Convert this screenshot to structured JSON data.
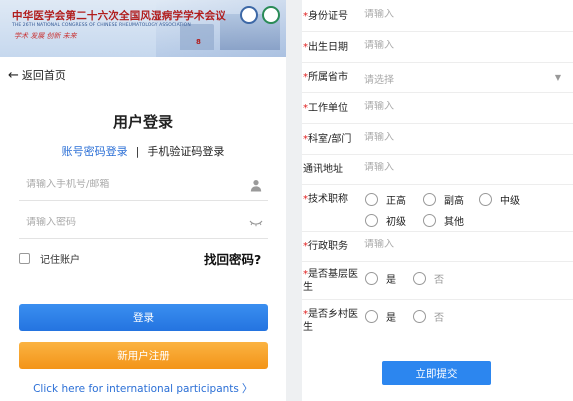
{
  "banner": {
    "title": "中华医学会第二十六次全国风湿病学学术会议",
    "subtitle": "THE 26TH NATIONAL CONGRESS OF CHINESE RHEUMATOLOGY ASSOCIATION",
    "slogan": "学术 发展 创新 未来",
    "year_mark": "8"
  },
  "nav": {
    "back_label": "返回首页"
  },
  "login": {
    "title": "用户登录",
    "tab_password": "账号密码登录",
    "tab_separator": "|",
    "tab_sms": "手机验证码登录",
    "username_placeholder": "请输入手机号/邮箱",
    "password_placeholder": "请输入密码",
    "remember_label": "记住账户",
    "forgot_label": "找回密码?",
    "login_button": "登录",
    "register_button": "新用户注册",
    "intl_link": "Click here for international participants",
    "intl_chevron": "〉"
  },
  "form": {
    "id_card": {
      "label": "身份证号",
      "placeholder": "请输入"
    },
    "birth_date": {
      "label": "出生日期",
      "placeholder": "请输入"
    },
    "province_city": {
      "label": "所属省市",
      "placeholder": "请选择"
    },
    "work_unit": {
      "label": "工作单位",
      "placeholder": "请输入"
    },
    "department": {
      "label": "科室/部门",
      "placeholder": "请输入"
    },
    "address": {
      "label": "通讯地址",
      "placeholder": "请输入"
    },
    "tech_title": {
      "label": "技术职称",
      "options": [
        "正高",
        "副高",
        "中级",
        "初级",
        "其他"
      ]
    },
    "admin_position": {
      "label": "行政职务",
      "placeholder": "请输入"
    },
    "grassroots_doctor": {
      "label_line1": "是否基层医",
      "label_line2": "生",
      "yes": "是",
      "no": "否"
    },
    "rural_doctor": {
      "label_line1": "是否乡村医",
      "label_line2": "生",
      "yes": "是",
      "no": "否"
    },
    "required_mark": "*",
    "submit_label": "立即提交"
  },
  "colors": {
    "primary_blue": "#2c86ef",
    "orange": "#f39418",
    "link_blue": "#2b6fd6",
    "required_red": "#e02020"
  }
}
